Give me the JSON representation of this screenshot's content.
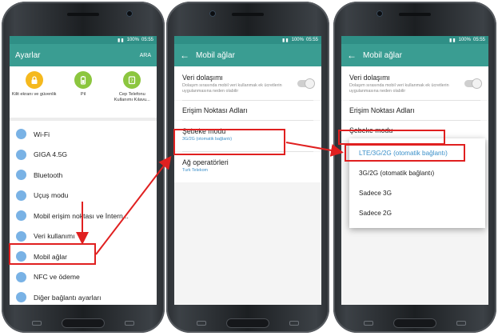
{
  "colors": {
    "header": "#3a9d92",
    "statusbar": "#2f8f86",
    "highlight": "#e02020",
    "accent_blue": "#3a8fc9"
  },
  "status": {
    "clock_1": "05:55",
    "clock_2": "05:55",
    "clock_3": "05:55",
    "battery_1": "100%",
    "battery_2": "100%",
    "battery_3": "100%"
  },
  "phone1": {
    "title": "Ayarlar",
    "search": "ARA",
    "quick": [
      {
        "label": "Kilit ekranı ve güvenlik",
        "icon": "lock-icon"
      },
      {
        "label": "Pil",
        "icon": "battery-icon"
      },
      {
        "label": "Cep Telefonu Kullanımı Kılavu...",
        "icon": "help-icon"
      }
    ],
    "items": [
      {
        "label": "Wi-Fi",
        "icon": "wifi-icon"
      },
      {
        "label": "GIGA 4.5G",
        "icon": "network-icon"
      },
      {
        "label": "Bluetooth",
        "icon": "bluetooth-icon"
      },
      {
        "label": "Uçuş modu",
        "icon": "airplane-icon"
      },
      {
        "label": "Mobil erişim noktası ve İntern...",
        "icon": "hotspot-icon"
      },
      {
        "label": "Veri kullanımı",
        "icon": "data-usage-icon"
      },
      {
        "label": "Mobil ağlar",
        "icon": "mobile-network-icon"
      },
      {
        "label": "NFC ve ödeme",
        "icon": "nfc-icon"
      },
      {
        "label": "Diğer bağlantı ayarları",
        "icon": "more-connections-icon"
      }
    ]
  },
  "phone2": {
    "title": "Mobil ağlar",
    "roaming_title": "Veri dolaşımı",
    "roaming_sub": "Dolaşım sırasında mobil veri kullanmak ek ücretlerin uygulanmasına neden olabilir",
    "apn": "Erişim Noktası Adları",
    "network_mode": "Şebeke modu",
    "network_mode_value": "3G/2G (otomatik bağlantı)",
    "operators": "Ağ operatörleri",
    "operators_value": "Turk Telekom"
  },
  "phone3": {
    "title": "Mobil ağlar",
    "roaming_title": "Veri dolaşımı",
    "roaming_sub": "Dolaşım sırasında mobil veri kullanmak ek ücretlerin uygulanmasına neden olabilir",
    "apn": "Erişim Noktası Adları",
    "network_mode": "Şebeke modu",
    "options": [
      "LTE/3G/2G (otomatik bağlantı)",
      "3G/2G (otomatik bağlantı)",
      "Sadece 3G",
      "Sadece 2G"
    ]
  }
}
